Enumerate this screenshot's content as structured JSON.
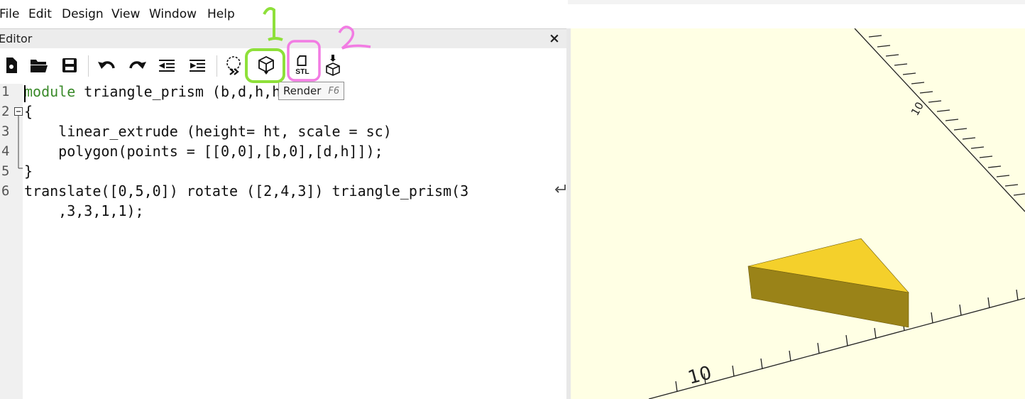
{
  "menu": {
    "items": [
      "File",
      "Edit",
      "Design",
      "View",
      "Window",
      "Help"
    ]
  },
  "editor": {
    "title": "Editor",
    "close": "×"
  },
  "toolbar": {
    "buttons": [
      "new-file",
      "open-file",
      "save-file",
      "undo",
      "redo",
      "unindent",
      "indent",
      "preview",
      "render",
      "export-stl",
      "send-to-print"
    ],
    "tooltip": {
      "label": "Render",
      "shortcut": "F6"
    }
  },
  "code": {
    "line_numbers": [
      "1",
      "2",
      "3",
      "4",
      "5",
      "6"
    ],
    "lines": [
      "module triangle_prism (b,d,h,ht,sc)",
      "{",
      "    linear_extrude (height= ht, scale = sc)",
      "    polygon(points = [[0,0],[b,0],[d,h]]);",
      "}",
      "translate([0,5,0]) rotate ([2,4,3]) triangle_prism(3",
      "    ,3,3,1,1);"
    ]
  },
  "annotations": {
    "one": "1",
    "two": "2",
    "one_color": "#8ee03a",
    "two_color": "#f27ce3"
  },
  "viewport": {
    "axis_label_top": "10",
    "axis_label_bottom": "10",
    "prism_top_color": "#f4d02b",
    "prism_side_color": "#9a8318"
  }
}
